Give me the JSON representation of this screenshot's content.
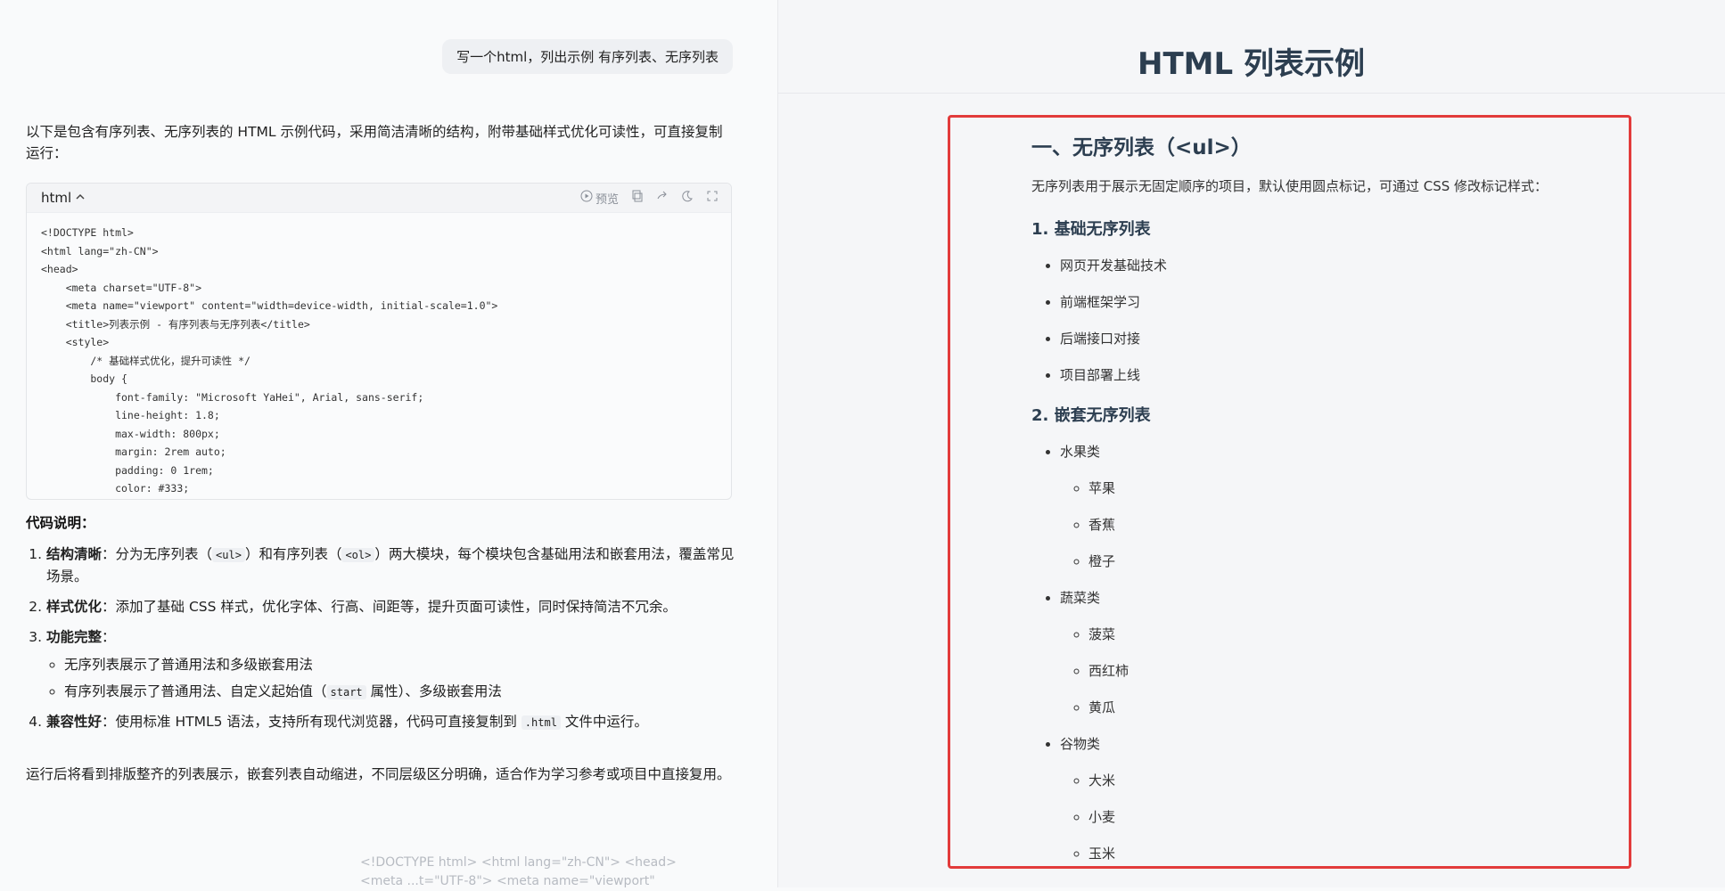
{
  "user_message": "写一个html，列出示例 有序列表、无序列表",
  "intro": "以下是包含有序列表、无序列表的 HTML 示例代码，采用简洁清晰的结构，附带基础样式优化可读性，可直接复制运行：",
  "code_block": {
    "lang": "html",
    "preview_label": "预览",
    "lines": [
      "<!DOCTYPE html>",
      "<html lang=\"zh-CN\">",
      "<head>",
      "    <meta charset=\"UTF-8\">",
      "    <meta name=\"viewport\" content=\"width=device-width, initial-scale=1.0\">",
      "    <title>列表示例 - 有序列表与无序列表</title>",
      "    <style>",
      "        /* 基础样式优化，提升可读性 */",
      "        body {",
      "            font-family: \"Microsoft YaHei\", Arial, sans-serif;",
      "            line-height: 1.8;",
      "            max-width: 800px;",
      "            margin: 2rem auto;",
      "            padding: 0 1rem;",
      "            color: #333;"
    ]
  },
  "explanation": {
    "title": "代码说明：",
    "items": [
      {
        "label": "结构清晰",
        "pre": "：分为无序列表（",
        "code1": "<ul>",
        "mid": "）和有序列表（",
        "code2": "<ol>",
        "post": "）两大模块，每个模块包含基础用法和嵌套用法，覆盖常见场景。"
      },
      {
        "label": "样式优化",
        "text": "：添加了基础 CSS 样式，优化字体、行高、间距等，提升页面可读性，同时保持简洁不冗余。"
      },
      {
        "label": "功能完整",
        "text": "：",
        "sub1": "无序列表展示了普通用法和多级嵌套用法",
        "sub2_pre": "有序列表展示了普通用法、自定义起始值（",
        "sub2_code": "start",
        "sub2_post": " 属性）、多级嵌套用法"
      },
      {
        "label": "兼容性好",
        "pre": "：使用标准 HTML5 语法，支持所有现代浏览器，代码可直接复制到 ",
        "code": ".html",
        "post": " 文件中运行。"
      }
    ]
  },
  "outro": "运行后将看到排版整齐的列表展示，嵌套列表自动缩进，不同层级区分明确，适合作为学习参考或项目中直接复用。",
  "ghost_text": "<!DOCTYPE html> <html lang=\"zh-CN\"> <head> <meta ...t=\"UTF-8\"> <meta name=\"viewport\"",
  "preview": {
    "title": "HTML 列表示例",
    "section_title": "一、无序列表（<ul>）",
    "section_desc": "无序列表用于展示无固定顺序的项目，默认使用圆点标记，可通过 CSS 修改标记样式：",
    "sub1_title": "1. 基础无序列表",
    "basic_items": [
      "网页开发基础技术",
      "前端框架学习",
      "后端接口对接",
      "项目部署上线"
    ],
    "sub2_title": "2. 嵌套无序列表",
    "nested": [
      {
        "label": "水果类",
        "children": [
          "苹果",
          "香蕉",
          "橙子"
        ]
      },
      {
        "label": "蔬菜类",
        "children": [
          "菠菜",
          "西红柿",
          "黄瓜"
        ]
      },
      {
        "label": "谷物类",
        "children": [
          "大米",
          "小麦",
          "玉米"
        ]
      }
    ]
  },
  "colors": {
    "highlight_border": "#e23b3b",
    "preview_heading": "#2c3e50"
  }
}
